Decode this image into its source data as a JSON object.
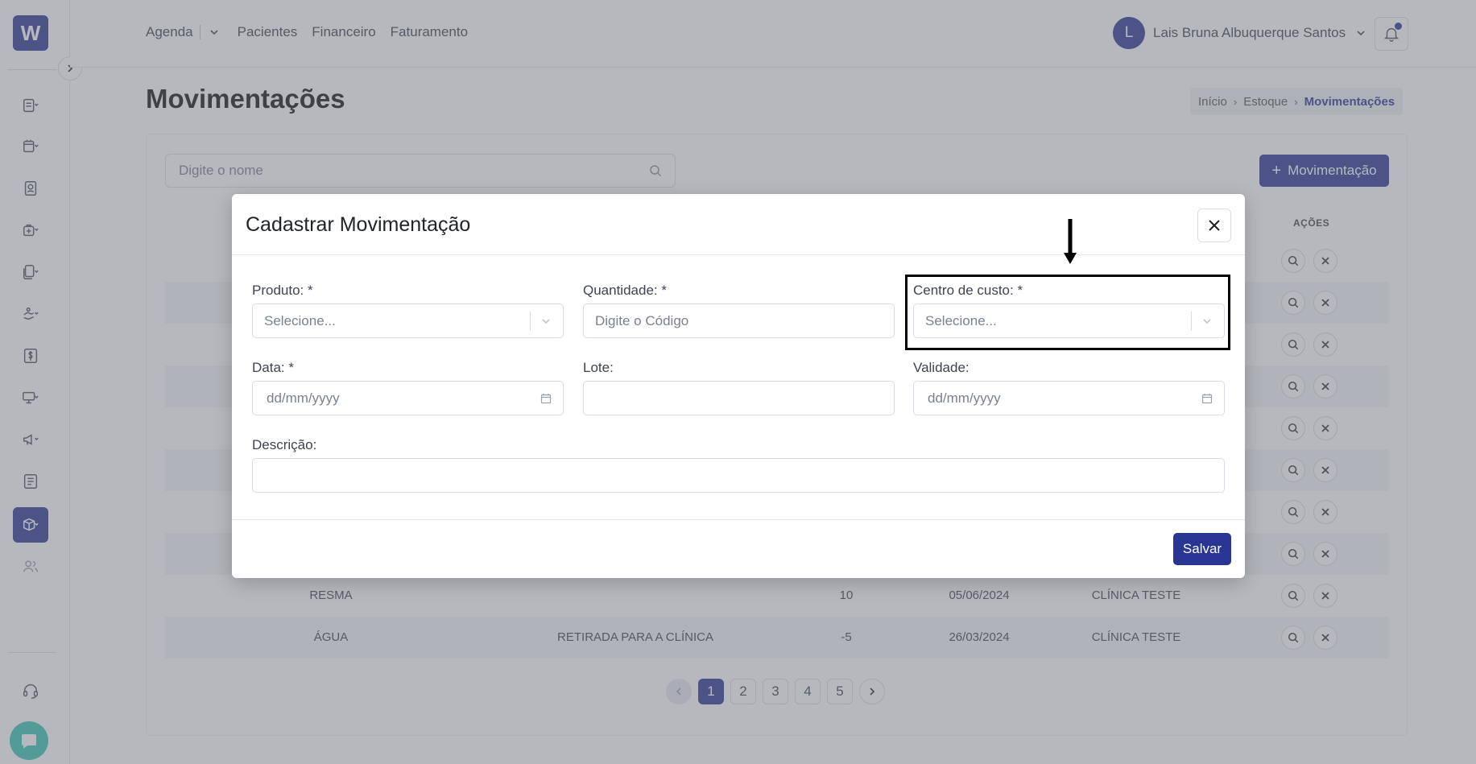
{
  "brand": {
    "logo_letter": "W"
  },
  "nav": {
    "items": [
      "Agenda",
      "Pacientes",
      "Financeiro",
      "Faturamento"
    ]
  },
  "user": {
    "initial": "L",
    "name": "Lais Bruna Albuquerque Santos"
  },
  "page": {
    "title": "Movimentações",
    "breadcrumb": [
      "Início",
      "Estoque",
      "Movimentações"
    ]
  },
  "list": {
    "search_placeholder": "Digite o nome",
    "add_button": "Movimentação",
    "actions_header": "AÇÕES",
    "rows": [
      {
        "produto": "RESMA",
        "descricao": "",
        "quantidade": "10",
        "data": "05/06/2024",
        "centro": "CLÍNICA TESTE"
      },
      {
        "produto": "ÁGUA",
        "descricao": "RETIRADA PARA A CLÍNICA",
        "quantidade": "-5",
        "data": "26/03/2024",
        "centro": "CLÍNICA TESTE"
      }
    ],
    "pagination": {
      "pages": [
        "1",
        "2",
        "3",
        "4",
        "5"
      ],
      "current": "1"
    }
  },
  "modal": {
    "title": "Cadastrar Movimentação",
    "fields": {
      "produto": {
        "label": "Produto: *",
        "placeholder": "Selecione..."
      },
      "quantidade": {
        "label": "Quantidade: *",
        "placeholder": "Digite o Código"
      },
      "centro_custo": {
        "label": "Centro de custo: *",
        "placeholder": "Selecione..."
      },
      "data": {
        "label": "Data: *",
        "placeholder": "dd/mm/yyyy"
      },
      "lote": {
        "label": "Lote:",
        "value": ""
      },
      "validade": {
        "label": "Validade:",
        "placeholder": "dd/mm/yyyy"
      },
      "descricao": {
        "label": "Descrição:",
        "value": ""
      }
    },
    "save_button": "Salvar"
  },
  "colors": {
    "primary": "#283593",
    "overlay": "#6e727c",
    "chat": "#36c5b5",
    "highlight_box": "#000000"
  },
  "icons": [
    "search-icon",
    "calendar-icon",
    "chevron-down-icon",
    "close-icon",
    "plus-icon",
    "bell-icon",
    "chat-icon",
    "headset-icon",
    "users-icon",
    "box-icon"
  ]
}
